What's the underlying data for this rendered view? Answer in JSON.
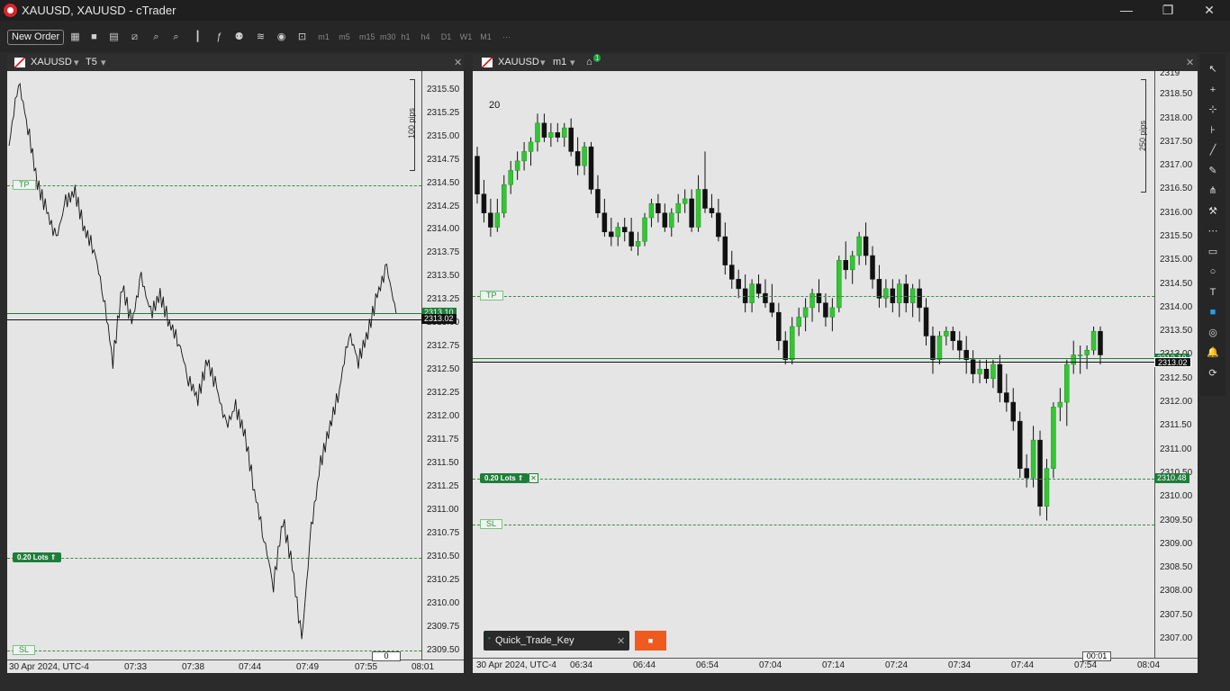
{
  "window": {
    "title": "XAUUSD, XAUUSD - cTrader",
    "minimize": "—",
    "restore": "❐",
    "close": "✕"
  },
  "toolbar": {
    "new_order": "New Order",
    "timeframes": [
      "m1",
      "m5",
      "m15",
      "m30",
      "h1",
      "h4",
      "D1",
      "W1",
      "M1",
      "···"
    ]
  },
  "left_chart": {
    "symbol": "XAUUSD",
    "period": "T5",
    "close": "✕",
    "price_labels": [
      "2315.50",
      "2315.25",
      "2315.00",
      "2314.75",
      "2314.50",
      "2314.25",
      "2314.00",
      "2313.75",
      "2313.50",
      "2313.25",
      "2313.00",
      "2312.75",
      "2312.50",
      "2312.25",
      "2312.00",
      "2311.75",
      "2311.50",
      "2311.25",
      "2311.00",
      "2310.75",
      "2310.50",
      "2310.25",
      "2310.00",
      "2309.75",
      "2309.50"
    ],
    "time_labels": [
      "30 Apr 2024, UTC-4",
      "07:33",
      "07:38",
      "07:44",
      "07:49",
      "07:55",
      "08:01"
    ],
    "ask_price": "2313.10",
    "bid_price": "2313.02",
    "tp_label": "TP",
    "sl_label": "SL",
    "lots_label": "0.20 Lots ⇑",
    "ruler_label": "100 pips",
    "countdown": "0",
    "chart_data": {
      "type": "line",
      "title": "",
      "x_range": [
        "07:28",
        "08:01"
      ],
      "ylim": [
        2309.4,
        2315.7
      ],
      "take_profit": 2314.48,
      "stop_loss": 2309.5,
      "order_price": 2310.48,
      "series": [
        {
          "values": [
            2314.9,
            2315.6,
            2315.1,
            2314.5,
            2314.2,
            2313.9,
            2314.3,
            2314.4,
            2314.0,
            2313.8,
            2313.3,
            2312.6,
            2313.4,
            2313.0,
            2313.5,
            2313.1,
            2313.3,
            2313.0,
            2312.8,
            2312.4,
            2312.2,
            2312.6,
            2312.3,
            2311.9,
            2312.1,
            2311.8,
            2311.2,
            2310.7,
            2310.2,
            2310.9,
            2310.4,
            2309.6,
            2310.8,
            2311.5,
            2311.9,
            2312.3,
            2312.9,
            2312.6,
            2312.9,
            2313.3,
            2313.6,
            2313.1
          ]
        }
      ]
    }
  },
  "right_chart": {
    "symbol": "XAUUSD",
    "period": "m1",
    "alert_count": "1",
    "close": "✕",
    "edit_icon": "✎",
    "count_label": "20",
    "price_labels": [
      "2318.50",
      "2318.00",
      "2317.50",
      "2317.00",
      "2316.50",
      "2316.00",
      "2315.50",
      "2315.00",
      "2314.50",
      "2314.00",
      "2313.50",
      "2313.00",
      "2312.50",
      "2312.00",
      "2311.50",
      "2311.00",
      "2310.50",
      "2310.00",
      "2309.50",
      "2309.00",
      "2308.50",
      "2308.00",
      "2307.50",
      "2307.00"
    ],
    "top_price_partial": "2319",
    "time_labels": [
      "30 Apr 2024, UTC-4",
      "06:34",
      "06:44",
      "06:54",
      "07:04",
      "07:14",
      "07:24",
      "07:34",
      "07:44",
      "07:54",
      "08:04"
    ],
    "ask_price": "2313.10",
    "bid_price": "2313.02",
    "order_price": "2310.48",
    "tp_label": "TP",
    "sl_label": "SL",
    "lots_label": "0.20 Lots ⇑",
    "lots_close": "✕",
    "ruler_label": "250 pips",
    "countdown": "00:01",
    "quick_trade": {
      "label": "Quick_Trade_Key",
      "close": "✕",
      "stop_icon": "■"
    },
    "chart_data": {
      "type": "candlestick",
      "title": "",
      "x_range": [
        "06:28",
        "08:04"
      ],
      "ylim": [
        2306.6,
        2319.0
      ],
      "take_profit": 2314.48,
      "stop_loss": 2309.5,
      "order_price": 2310.48,
      "up_color": "#34c534",
      "down_color": "#111111",
      "ohlc": [
        [
          2317.2,
          2317.4,
          2316.2,
          2316.4
        ],
        [
          2316.4,
          2316.7,
          2315.8,
          2316.0
        ],
        [
          2316.0,
          2316.3,
          2315.5,
          2315.7
        ],
        [
          2315.7,
          2316.3,
          2315.6,
          2316.0
        ],
        [
          2316.0,
          2316.8,
          2315.9,
          2316.6
        ],
        [
          2316.6,
          2317.1,
          2316.4,
          2316.9
        ],
        [
          2316.9,
          2317.3,
          2316.7,
          2317.1
        ],
        [
          2317.1,
          2317.5,
          2316.9,
          2317.3
        ],
        [
          2317.3,
          2317.6,
          2317.0,
          2317.5
        ],
        [
          2317.5,
          2318.1,
          2317.3,
          2317.9
        ],
        [
          2317.9,
          2318.1,
          2317.5,
          2317.6
        ],
        [
          2317.6,
          2317.9,
          2317.4,
          2317.7
        ],
        [
          2317.7,
          2317.9,
          2317.5,
          2317.6
        ],
        [
          2317.6,
          2317.9,
          2317.4,
          2317.8
        ],
        [
          2317.8,
          2318.0,
          2317.2,
          2317.3
        ],
        [
          2317.3,
          2317.6,
          2316.8,
          2317.0
        ],
        [
          2317.0,
          2317.5,
          2316.8,
          2317.4
        ],
        [
          2317.4,
          2317.5,
          2316.4,
          2316.5
        ],
        [
          2316.5,
          2316.8,
          2315.9,
          2316.0
        ],
        [
          2316.0,
          2316.3,
          2315.5,
          2315.6
        ],
        [
          2315.6,
          2315.9,
          2315.3,
          2315.5
        ],
        [
          2315.5,
          2315.8,
          2315.3,
          2315.7
        ],
        [
          2315.7,
          2315.9,
          2315.4,
          2315.6
        ],
        [
          2315.6,
          2315.9,
          2315.2,
          2315.3
        ],
        [
          2315.3,
          2315.6,
          2315.1,
          2315.4
        ],
        [
          2315.4,
          2316.0,
          2315.3,
          2315.9
        ],
        [
          2315.9,
          2316.3,
          2315.7,
          2316.2
        ],
        [
          2316.2,
          2316.4,
          2315.8,
          2316.0
        ],
        [
          2316.0,
          2316.2,
          2315.6,
          2315.7
        ],
        [
          2315.7,
          2316.1,
          2315.5,
          2316.0
        ],
        [
          2316.0,
          2316.4,
          2315.8,
          2316.2
        ],
        [
          2316.2,
          2316.5,
          2316.0,
          2316.3
        ],
        [
          2316.3,
          2316.5,
          2315.6,
          2315.7
        ],
        [
          2315.7,
          2316.8,
          2315.6,
          2316.5
        ],
        [
          2316.5,
          2317.3,
          2316.0,
          2316.1
        ],
        [
          2316.1,
          2316.4,
          2315.9,
          2316.0
        ],
        [
          2316.0,
          2316.3,
          2315.4,
          2315.5
        ],
        [
          2315.5,
          2315.8,
          2314.7,
          2314.9
        ],
        [
          2314.9,
          2315.2,
          2314.4,
          2314.6
        ],
        [
          2314.6,
          2314.8,
          2314.2,
          2314.4
        ],
        [
          2314.4,
          2314.7,
          2313.9,
          2314.1
        ],
        [
          2314.1,
          2314.6,
          2313.9,
          2314.5
        ],
        [
          2314.5,
          2314.7,
          2314.2,
          2314.3
        ],
        [
          2314.3,
          2314.6,
          2314.0,
          2314.1
        ],
        [
          2314.1,
          2314.5,
          2313.8,
          2313.9
        ],
        [
          2313.9,
          2314.1,
          2313.1,
          2313.3
        ],
        [
          2313.3,
          2313.5,
          2312.8,
          2312.9
        ],
        [
          2312.9,
          2313.8,
          2312.8,
          2313.6
        ],
        [
          2313.6,
          2314.0,
          2313.4,
          2313.8
        ],
        [
          2313.8,
          2314.2,
          2313.5,
          2314.0
        ],
        [
          2314.0,
          2314.4,
          2313.7,
          2314.3
        ],
        [
          2314.3,
          2314.6,
          2313.9,
          2314.1
        ],
        [
          2314.1,
          2314.3,
          2313.6,
          2313.8
        ],
        [
          2313.8,
          2314.2,
          2313.5,
          2314.0
        ],
        [
          2314.0,
          2315.1,
          2313.9,
          2315.0
        ],
        [
          2315.0,
          2315.4,
          2314.6,
          2314.8
        ],
        [
          2314.8,
          2315.2,
          2314.5,
          2315.1
        ],
        [
          2315.1,
          2315.6,
          2314.9,
          2315.5
        ],
        [
          2315.5,
          2315.8,
          2314.9,
          2315.1
        ],
        [
          2315.1,
          2315.3,
          2314.4,
          2314.6
        ],
        [
          2314.6,
          2314.9,
          2314.0,
          2314.2
        ],
        [
          2314.2,
          2314.6,
          2314.0,
          2314.4
        ],
        [
          2314.4,
          2314.6,
          2313.9,
          2314.1
        ],
        [
          2314.1,
          2314.6,
          2313.8,
          2314.5
        ],
        [
          2314.5,
          2314.7,
          2313.9,
          2314.1
        ],
        [
          2314.1,
          2314.5,
          2313.8,
          2314.4
        ],
        [
          2314.4,
          2314.6,
          2313.7,
          2314.0
        ],
        [
          2314.0,
          2314.2,
          2313.2,
          2313.4
        ],
        [
          2313.4,
          2313.6,
          2312.6,
          2312.9
        ],
        [
          2312.9,
          2313.5,
          2312.8,
          2313.4
        ],
        [
          2313.4,
          2313.6,
          2313.2,
          2313.5
        ],
        [
          2313.5,
          2313.6,
          2313.1,
          2313.3
        ],
        [
          2313.3,
          2313.5,
          2312.9,
          2313.1
        ],
        [
          2313.1,
          2313.4,
          2312.6,
          2312.9
        ],
        [
          2312.9,
          2313.1,
          2312.4,
          2312.6
        ],
        [
          2312.6,
          2312.9,
          2312.4,
          2312.7
        ],
        [
          2312.7,
          2312.9,
          2312.4,
          2312.5
        ],
        [
          2312.5,
          2312.9,
          2312.3,
          2312.8
        ],
        [
          2312.8,
          2313.0,
          2312.0,
          2312.2
        ],
        [
          2312.2,
          2312.6,
          2311.8,
          2312.0
        ],
        [
          2312.0,
          2312.3,
          2311.4,
          2311.6
        ],
        [
          2311.6,
          2311.8,
          2310.4,
          2310.6
        ],
        [
          2310.6,
          2310.9,
          2310.2,
          2310.4
        ],
        [
          2310.4,
          2311.5,
          2310.2,
          2311.2
        ],
        [
          2311.2,
          2311.4,
          2309.6,
          2309.8
        ],
        [
          2309.8,
          2310.8,
          2309.5,
          2310.6
        ],
        [
          2310.6,
          2312.0,
          2310.4,
          2311.9
        ],
        [
          2311.9,
          2312.3,
          2311.6,
          2312.0
        ],
        [
          2312.0,
          2312.9,
          2311.5,
          2312.8
        ],
        [
          2312.8,
          2313.3,
          2312.6,
          2313.0
        ],
        [
          2313.0,
          2313.2,
          2312.6,
          2313.0
        ],
        [
          2313.0,
          2313.2,
          2312.7,
          2313.1
        ],
        [
          2313.1,
          2313.6,
          2313.0,
          2313.5
        ],
        [
          2313.5,
          2313.6,
          2312.8,
          2313.0
        ]
      ]
    }
  },
  "drawing_tools": [
    "↖",
    "+",
    "⊹",
    "⊦",
    "╱",
    "✎",
    "⋔",
    "⚒",
    "⋯",
    "▭",
    "○",
    "T",
    "■",
    "◎",
    "🔔",
    "⟳"
  ]
}
